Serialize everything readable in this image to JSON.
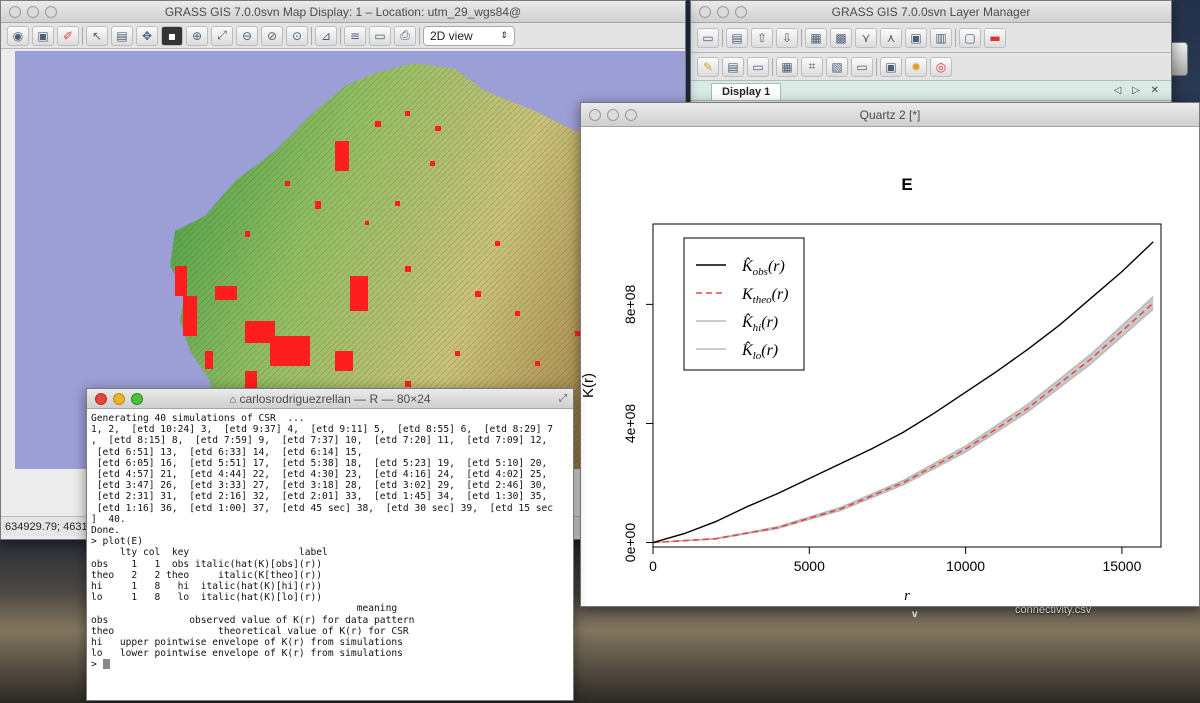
{
  "map_display": {
    "title": "GRASS GIS 7.0.0svn Map Display: 1  – Location: utm_29_wgs84@",
    "view_mode": "2D view",
    "coords": "634929.79; 4631",
    "map_bg_color": "#9c9ed6"
  },
  "layer_manager": {
    "title": "GRASS GIS 7.0.0svn Layer Manager",
    "tab_label": "Display 1",
    "tab_controls": "◁ ▷ ✕"
  },
  "quartz": {
    "title": "Quartz 2 [*]"
  },
  "terminal": {
    "title": "carlosrodriguezrellan — R — 80×24",
    "lines": [
      "Generating 40 simulations of CSR  ...",
      "1, 2,  [etd 10:24] 3,  [etd 9:37] 4,  [etd 9:11] 5,  [etd 8:55] 6,  [etd 8:29] 7",
      ",  [etd 8:15] 8,  [etd 7:59] 9,  [etd 7:37] 10,  [etd 7:20] 11,  [etd 7:09] 12,",
      " [etd 6:51] 13,  [etd 6:33] 14,  [etd 6:14] 15,",
      " [etd 6:05] 16,  [etd 5:51] 17,  [etd 5:38] 18,  [etd 5:23] 19,  [etd 5:10] 20,",
      " [etd 4:57] 21,  [etd 4:44] 22,  [etd 4:30] 23,  [etd 4:16] 24,  [etd 4:02] 25,",
      " [etd 3:47] 26,  [etd 3:33] 27,  [etd 3:18] 28,  [etd 3:02] 29,  [etd 2:46] 30,",
      " [etd 2:31] 31,  [etd 2:16] 32,  [etd 2:01] 33,  [etd 1:45] 34,  [etd 1:30] 35,",
      " [etd 1:16] 36,  [etd 1:00] 37,  [etd 45 sec] 38,  [etd 30 sec] 39,  [etd 15 sec",
      "]  40.",
      "",
      "Done.",
      "> plot(E)",
      "     lty col  key                   label",
      "obs    1   1  obs italic(hat(K)[obs](r))",
      "theo   2   2 theo     italic(K[theo](r))",
      "hi     1   8   hi  italic(hat(K)[hi](r))",
      "lo     1   8   lo  italic(hat(K)[lo](r))",
      "                                              meaning",
      "obs              observed value of K(r) for data pattern",
      "theo                  theoretical value of K(r) for CSR",
      "hi   upper pointwise envelope of K(r) from simulations",
      "lo   lower pointwise envelope of K(r) from simulations",
      "> "
    ]
  },
  "desktop": {
    "file_label": "connectivity.csv",
    "v_label": "v"
  },
  "chart_data": {
    "type": "line",
    "title": "E",
    "xlabel": "r",
    "ylabel": "K(r)",
    "xlim": [
      0,
      16250
    ],
    "ylim": [
      -15000000,
      1070000000
    ],
    "xticks": [
      0,
      5000,
      10000,
      15000
    ],
    "xtick_labels": [
      "0",
      "5000",
      "10000",
      "15000"
    ],
    "yticks": [
      0,
      400000000,
      800000000
    ],
    "ytick_labels": [
      "0e+00",
      "4e+08",
      "8e+08"
    ],
    "legend_position": "top-left",
    "series": [
      {
        "name": "Kobs(r)",
        "color": "#000000",
        "dash": false,
        "x": [
          0,
          1000,
          2000,
          3000,
          4000,
          5000,
          6000,
          7000,
          8000,
          9000,
          10000,
          11000,
          12000,
          13000,
          14000,
          15000,
          16000
        ],
        "y": [
          0,
          30000000,
          70000000,
          120000000,
          165000000,
          215000000,
          265000000,
          315000000,
          370000000,
          435000000,
          505000000,
          575000000,
          650000000,
          730000000,
          820000000,
          910000000,
          1010000000
        ]
      },
      {
        "name": "Ktheo(r)",
        "color": "#e8443f",
        "dash": true,
        "x": [
          0,
          2000,
          4000,
          6000,
          8000,
          10000,
          12000,
          14000,
          16000
        ],
        "y": [
          0,
          12600000,
          50300000,
          113000000,
          201000000,
          314000000,
          452000000,
          616000000,
          804000000
        ]
      },
      {
        "name": "Khi(r)",
        "color": "#b8b8b8",
        "dash": false,
        "x": [
          0,
          2000,
          4000,
          6000,
          8000,
          10000,
          12000,
          14000,
          16000
        ],
        "y": [
          0,
          13500000,
          53000000,
          118000000,
          208000000,
          324000000,
          465000000,
          632000000,
          826000000
        ]
      },
      {
        "name": "Klo(r)",
        "color": "#b8b8b8",
        "dash": false,
        "x": [
          0,
          2000,
          4000,
          6000,
          8000,
          10000,
          12000,
          14000,
          16000
        ],
        "y": [
          0,
          11800000,
          47800000,
          108000000,
          194000000,
          304000000,
          440000000,
          600000000,
          784000000
        ]
      }
    ]
  }
}
